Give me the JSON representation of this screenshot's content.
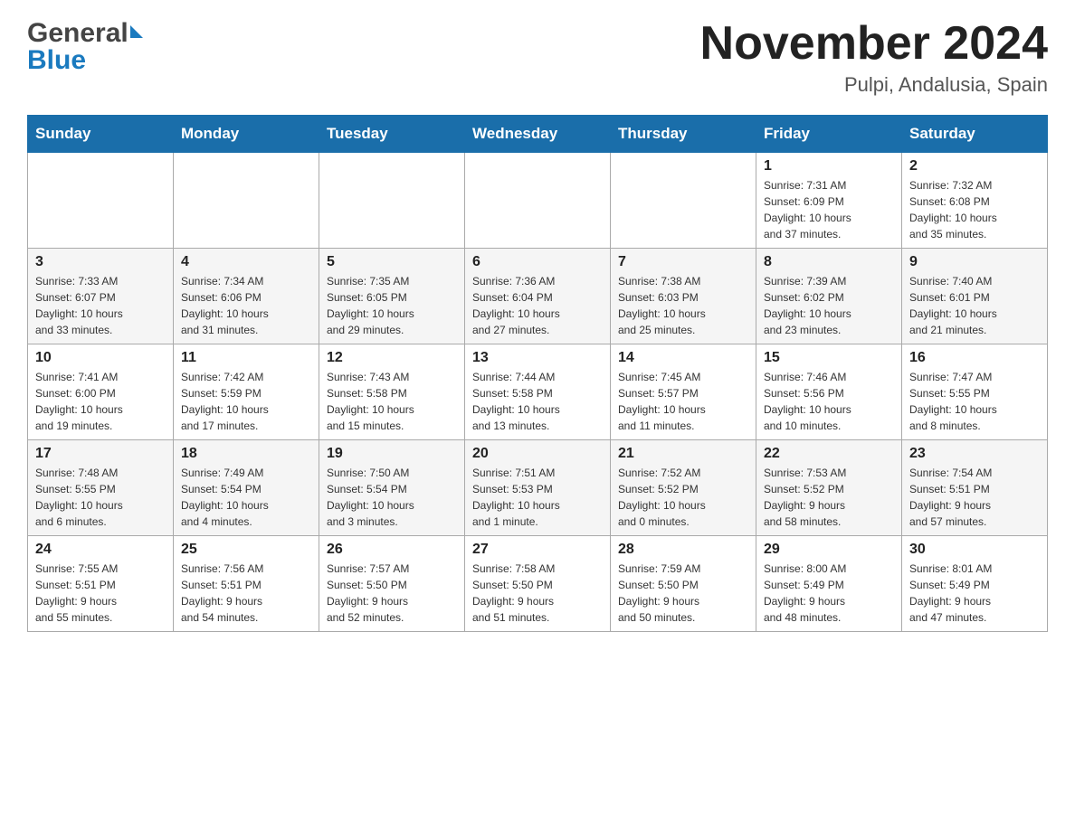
{
  "header": {
    "title": "November 2024",
    "location": "Pulpi, Andalusia, Spain",
    "logo_general": "General",
    "logo_blue": "Blue"
  },
  "weekdays": [
    "Sunday",
    "Monday",
    "Tuesday",
    "Wednesday",
    "Thursday",
    "Friday",
    "Saturday"
  ],
  "rows": [
    [
      {
        "day": "",
        "info": ""
      },
      {
        "day": "",
        "info": ""
      },
      {
        "day": "",
        "info": ""
      },
      {
        "day": "",
        "info": ""
      },
      {
        "day": "",
        "info": ""
      },
      {
        "day": "1",
        "info": "Sunrise: 7:31 AM\nSunset: 6:09 PM\nDaylight: 10 hours\nand 37 minutes."
      },
      {
        "day": "2",
        "info": "Sunrise: 7:32 AM\nSunset: 6:08 PM\nDaylight: 10 hours\nand 35 minutes."
      }
    ],
    [
      {
        "day": "3",
        "info": "Sunrise: 7:33 AM\nSunset: 6:07 PM\nDaylight: 10 hours\nand 33 minutes."
      },
      {
        "day": "4",
        "info": "Sunrise: 7:34 AM\nSunset: 6:06 PM\nDaylight: 10 hours\nand 31 minutes."
      },
      {
        "day": "5",
        "info": "Sunrise: 7:35 AM\nSunset: 6:05 PM\nDaylight: 10 hours\nand 29 minutes."
      },
      {
        "day": "6",
        "info": "Sunrise: 7:36 AM\nSunset: 6:04 PM\nDaylight: 10 hours\nand 27 minutes."
      },
      {
        "day": "7",
        "info": "Sunrise: 7:38 AM\nSunset: 6:03 PM\nDaylight: 10 hours\nand 25 minutes."
      },
      {
        "day": "8",
        "info": "Sunrise: 7:39 AM\nSunset: 6:02 PM\nDaylight: 10 hours\nand 23 minutes."
      },
      {
        "day": "9",
        "info": "Sunrise: 7:40 AM\nSunset: 6:01 PM\nDaylight: 10 hours\nand 21 minutes."
      }
    ],
    [
      {
        "day": "10",
        "info": "Sunrise: 7:41 AM\nSunset: 6:00 PM\nDaylight: 10 hours\nand 19 minutes."
      },
      {
        "day": "11",
        "info": "Sunrise: 7:42 AM\nSunset: 5:59 PM\nDaylight: 10 hours\nand 17 minutes."
      },
      {
        "day": "12",
        "info": "Sunrise: 7:43 AM\nSunset: 5:58 PM\nDaylight: 10 hours\nand 15 minutes."
      },
      {
        "day": "13",
        "info": "Sunrise: 7:44 AM\nSunset: 5:58 PM\nDaylight: 10 hours\nand 13 minutes."
      },
      {
        "day": "14",
        "info": "Sunrise: 7:45 AM\nSunset: 5:57 PM\nDaylight: 10 hours\nand 11 minutes."
      },
      {
        "day": "15",
        "info": "Sunrise: 7:46 AM\nSunset: 5:56 PM\nDaylight: 10 hours\nand 10 minutes."
      },
      {
        "day": "16",
        "info": "Sunrise: 7:47 AM\nSunset: 5:55 PM\nDaylight: 10 hours\nand 8 minutes."
      }
    ],
    [
      {
        "day": "17",
        "info": "Sunrise: 7:48 AM\nSunset: 5:55 PM\nDaylight: 10 hours\nand 6 minutes."
      },
      {
        "day": "18",
        "info": "Sunrise: 7:49 AM\nSunset: 5:54 PM\nDaylight: 10 hours\nand 4 minutes."
      },
      {
        "day": "19",
        "info": "Sunrise: 7:50 AM\nSunset: 5:54 PM\nDaylight: 10 hours\nand 3 minutes."
      },
      {
        "day": "20",
        "info": "Sunrise: 7:51 AM\nSunset: 5:53 PM\nDaylight: 10 hours\nand 1 minute."
      },
      {
        "day": "21",
        "info": "Sunrise: 7:52 AM\nSunset: 5:52 PM\nDaylight: 10 hours\nand 0 minutes."
      },
      {
        "day": "22",
        "info": "Sunrise: 7:53 AM\nSunset: 5:52 PM\nDaylight: 9 hours\nand 58 minutes."
      },
      {
        "day": "23",
        "info": "Sunrise: 7:54 AM\nSunset: 5:51 PM\nDaylight: 9 hours\nand 57 minutes."
      }
    ],
    [
      {
        "day": "24",
        "info": "Sunrise: 7:55 AM\nSunset: 5:51 PM\nDaylight: 9 hours\nand 55 minutes."
      },
      {
        "day": "25",
        "info": "Sunrise: 7:56 AM\nSunset: 5:51 PM\nDaylight: 9 hours\nand 54 minutes."
      },
      {
        "day": "26",
        "info": "Sunrise: 7:57 AM\nSunset: 5:50 PM\nDaylight: 9 hours\nand 52 minutes."
      },
      {
        "day": "27",
        "info": "Sunrise: 7:58 AM\nSunset: 5:50 PM\nDaylight: 9 hours\nand 51 minutes."
      },
      {
        "day": "28",
        "info": "Sunrise: 7:59 AM\nSunset: 5:50 PM\nDaylight: 9 hours\nand 50 minutes."
      },
      {
        "day": "29",
        "info": "Sunrise: 8:00 AM\nSunset: 5:49 PM\nDaylight: 9 hours\nand 48 minutes."
      },
      {
        "day": "30",
        "info": "Sunrise: 8:01 AM\nSunset: 5:49 PM\nDaylight: 9 hours\nand 47 minutes."
      }
    ]
  ]
}
